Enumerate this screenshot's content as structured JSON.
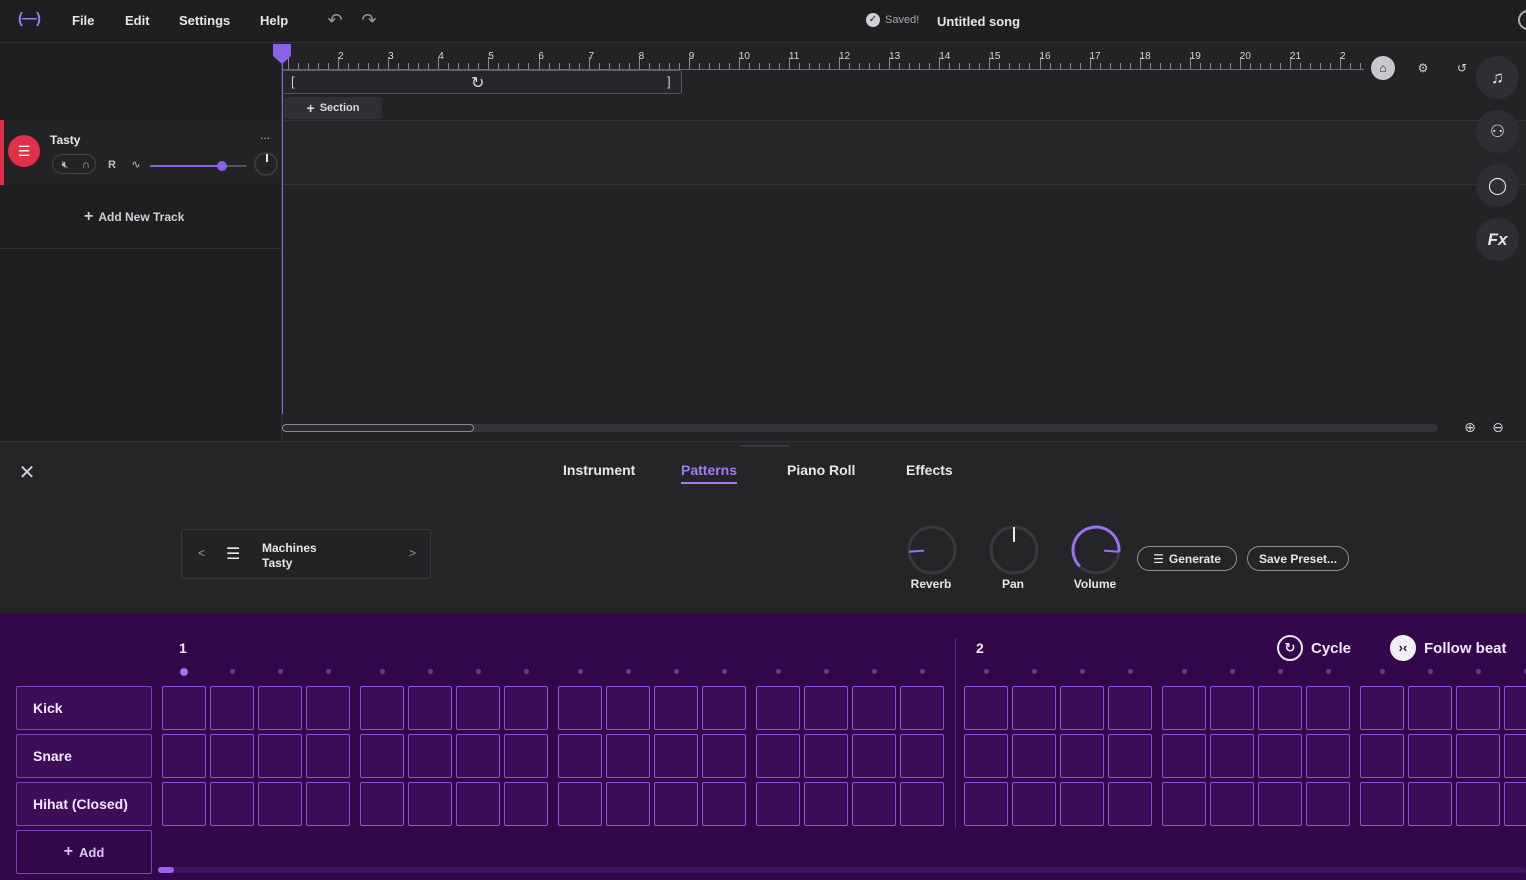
{
  "app": {
    "logo": "(—)",
    "menu": [
      "File",
      "Edit",
      "Settings",
      "Help"
    ],
    "saved_text": "Saved!",
    "song_title": "Untitled song"
  },
  "timeline": {
    "bar_numbers": [
      "2",
      "3",
      "4",
      "5",
      "6",
      "7",
      "8",
      "9",
      "10",
      "11",
      "12",
      "13",
      "14",
      "15",
      "16",
      "17",
      "18",
      "19",
      "20",
      "21",
      "2"
    ],
    "section_label": "Section"
  },
  "track": {
    "name": "Tasty",
    "menu": "...",
    "record_label": "R",
    "volume": 0.75,
    "add_track_label": "Add New Track"
  },
  "side_buttons": {
    "fx_label": "Fx"
  },
  "editor": {
    "tabs": [
      "Instrument",
      "Patterns",
      "Piano Roll",
      "Effects"
    ],
    "active_tab": "Patterns",
    "preset": {
      "category": "Machines",
      "name": "Tasty"
    },
    "knobs": [
      {
        "label": "Reverb",
        "value": 0.15
      },
      {
        "label": "Pan",
        "value": 0.5
      },
      {
        "label": "Volume",
        "value": 0.85
      }
    ],
    "generate_label": "Generate",
    "save_preset_label": "Save Preset..."
  },
  "sequencer": {
    "bar_labels": [
      "1",
      "2"
    ],
    "cycle_label": "Cycle",
    "follow_beat_label": "Follow beat",
    "rows": [
      "Kick",
      "Snare",
      "Hihat (Closed)"
    ],
    "add_label": "Add",
    "accent": "#8a52d8"
  }
}
